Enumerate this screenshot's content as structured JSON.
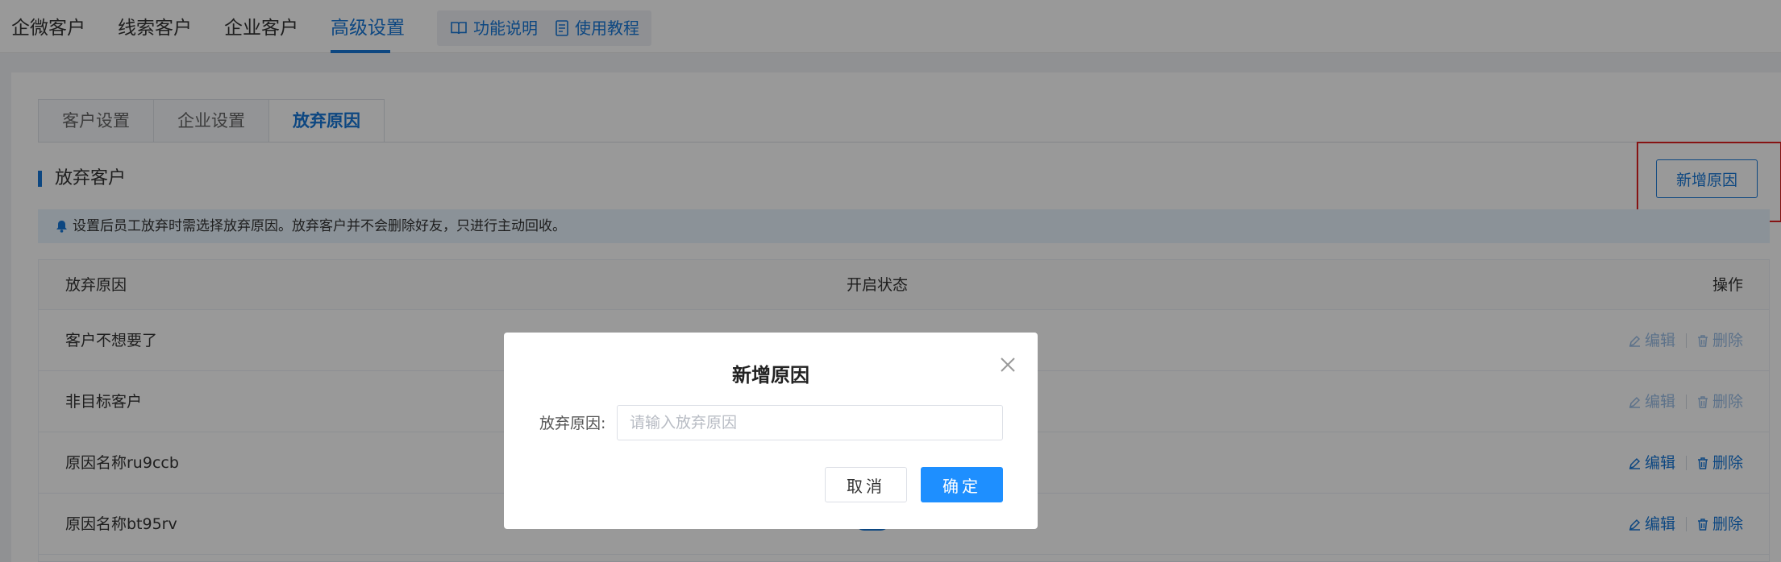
{
  "topnav": {
    "items": [
      {
        "label": "企微客户",
        "active": false
      },
      {
        "label": "线索客户",
        "active": false
      },
      {
        "label": "企业客户",
        "active": false
      },
      {
        "label": "高级设置",
        "active": true
      }
    ],
    "tools": [
      {
        "label": "功能说明",
        "icon": "book-icon"
      },
      {
        "label": "使用教程",
        "icon": "document-icon"
      }
    ]
  },
  "tabs": [
    {
      "label": "客户设置",
      "active": false
    },
    {
      "label": "企业设置",
      "active": false
    },
    {
      "label": "放弃原因",
      "active": true
    }
  ],
  "section": {
    "title": "放弃客户",
    "add_button": "新增原因",
    "notice": "设置后员工放弃时需选择放弃原因。放弃客户并不会删除好友，只进行主动回收。"
  },
  "table": {
    "columns": [
      "放弃原因",
      "开启状态",
      "操作"
    ],
    "rows": [
      {
        "name": "客户不想要了",
        "editable": false
      },
      {
        "name": "非目标客户",
        "editable": false
      },
      {
        "name": "原因名称ru9ccb",
        "editable": true
      },
      {
        "name": "原因名称bt95rv",
        "editable": true,
        "enabled": true
      }
    ],
    "edit_label": "编辑",
    "delete_label": "删除"
  },
  "modal": {
    "title": "新增原因",
    "field_label": "放弃原因:",
    "field_placeholder": "请输入放弃原因",
    "field_value": "",
    "cancel_label": "取消",
    "ok_label": "确定"
  },
  "colors": {
    "primary": "#1677d8",
    "ok_button": "#1e8fff",
    "highlight": "#e02020"
  }
}
